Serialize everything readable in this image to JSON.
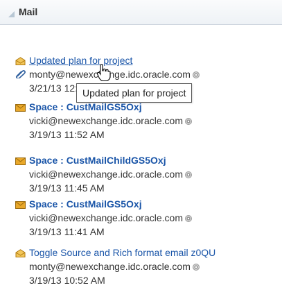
{
  "header": {
    "title": "Mail"
  },
  "items": [
    {
      "subject": "Updated plan for project",
      "sender": "monty@newexchange.idc.oracle.com",
      "date": "3/21/13 12:0",
      "icon": "open-envelope-icon",
      "attachment": true
    },
    {
      "subject": "Space : CustMailGS5Oxj",
      "sender": "vicki@newexchange.idc.oracle.com",
      "date": "3/19/13 11:52 AM",
      "icon": "closed-envelope-icon"
    },
    {
      "subject": "Space : CustMailChildGS5Oxj",
      "sender": "vicki@newexchange.idc.oracle.com",
      "date": "3/19/13 11:45 AM",
      "icon": "closed-envelope-icon"
    },
    {
      "subject": "Space : CustMailGS5Oxj",
      "sender": "vicki@newexchange.idc.oracle.com",
      "date": "3/19/13 11:41 AM",
      "icon": "closed-envelope-icon"
    },
    {
      "subject": "Toggle Source and Rich format email z0QU",
      "sender": "monty@newexchange.idc.oracle.com",
      "date": "3/19/13 10:52 AM",
      "icon": "open-envelope-icon"
    }
  ],
  "tooltip": {
    "text": "Updated plan for project"
  },
  "colors": {
    "link": "#1a55a8",
    "envelope_open": "#e3a41c",
    "envelope_closed": "#d89a1a",
    "header_bg": "#eef2f6"
  }
}
